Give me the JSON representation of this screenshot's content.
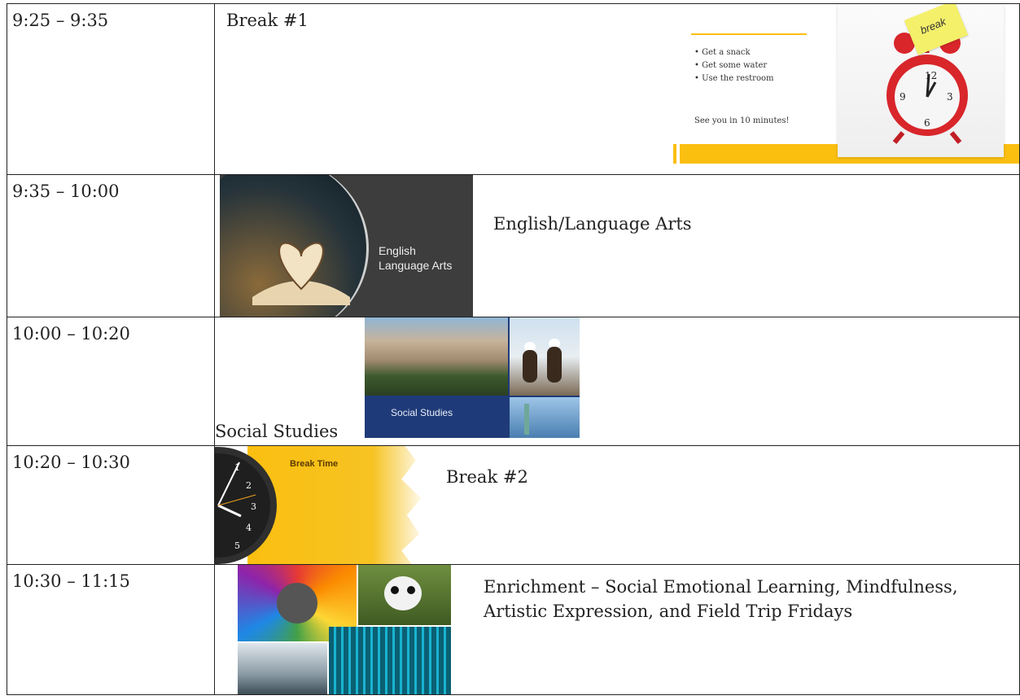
{
  "rows": [
    {
      "time": "9:25 – 9:35",
      "activity": "Break #1"
    },
    {
      "time": "9:35 – 10:00",
      "activity": "English/Language Arts"
    },
    {
      "time": "10:00 – 10:20",
      "activity": "Social Studies"
    },
    {
      "time": "10:20 – 10:30",
      "activity": "Break #2"
    },
    {
      "time": "10:30 – 11:15",
      "activity_line1": "Enrichment – Social Emotional Learning, Mindfulness,",
      "activity_line2": "Artistic Expression, and Field Trip Fridays"
    }
  ],
  "break1_slide": {
    "bullets": [
      "• Get a snack",
      "• Get some water",
      "• Use the restroom"
    ],
    "footer": "See you in 10 minutes!",
    "sticky_note": "break"
  },
  "ela_slide": {
    "line1": "English",
    "line2": "Language Arts"
  },
  "social_slide": {
    "caption": "Social Studies"
  },
  "break2_slide": {
    "title": "Break Time"
  },
  "colors": {
    "accent_yellow": "#fbbf10",
    "slide_dark": "#3d3d3d",
    "social_blue": "#1f3a78",
    "sticky": "#f4f06a",
    "clock_red": "#d8262b"
  }
}
